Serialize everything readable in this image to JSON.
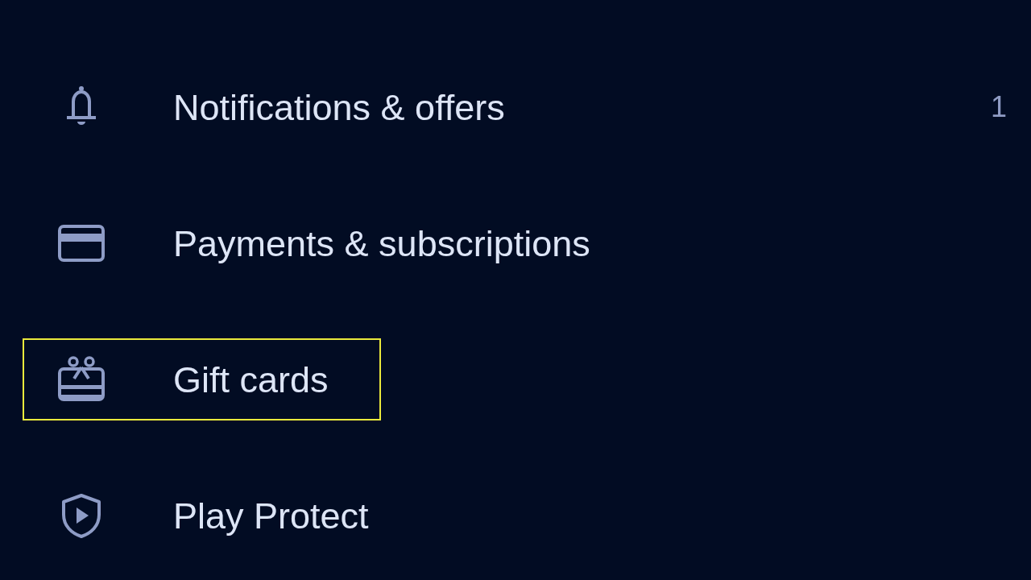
{
  "menu": {
    "items": [
      {
        "kind": "notifications",
        "label": "Notifications & offers",
        "count": "1",
        "selected": false
      },
      {
        "kind": "payments",
        "label": "Payments & subscriptions",
        "selected": false
      },
      {
        "kind": "giftcards",
        "label": "Gift cards",
        "selected": true
      },
      {
        "kind": "protect",
        "label": "Play Protect",
        "selected": false
      }
    ]
  }
}
